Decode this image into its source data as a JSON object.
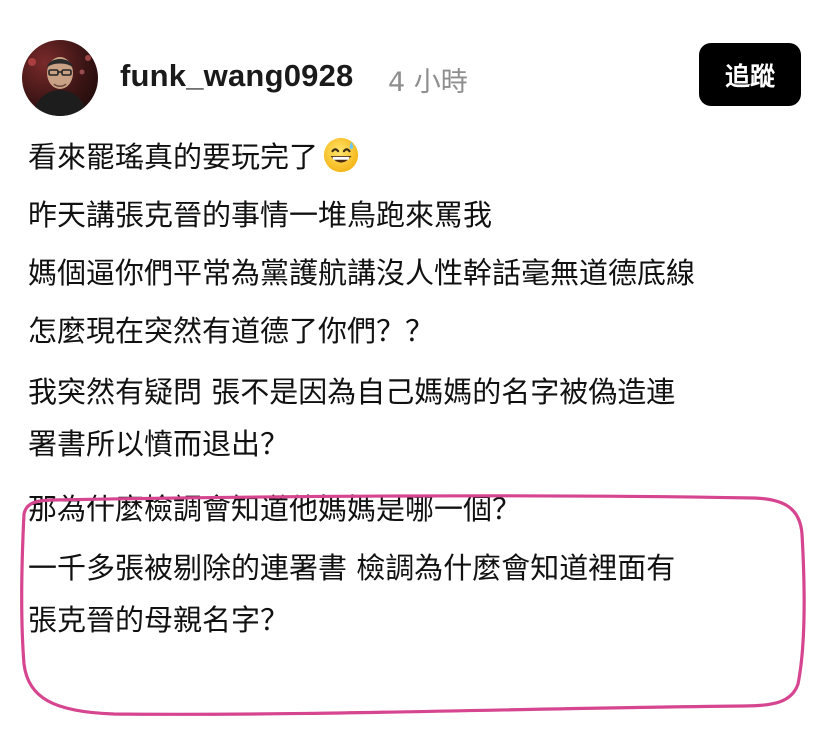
{
  "header": {
    "username": "funk_wang0928",
    "timestamp": "4 小時",
    "follow_label": "追蹤"
  },
  "post": {
    "lines": [
      "看來罷瑤真的要玩完了",
      "昨天講張克晉的事情一堆鳥跑來罵我",
      "媽個逼你們平常為黨護航講沒人性幹話毫無道德底線",
      "怎麼現在突然有道德了你們？？",
      "我突然有疑問  張不是因為自己媽媽的名字被偽造連",
      "署書所以憤而退出？",
      "那為什麼檢調會知道他媽媽是哪一個？",
      "一千多張被剔除的連署書  檢調為什麼會知道裡面有",
      "張克晉的母親名字？"
    ],
    "emoji": "grinning-face-with-sweat-icon"
  },
  "annotation": {
    "color": "#d6458f"
  }
}
